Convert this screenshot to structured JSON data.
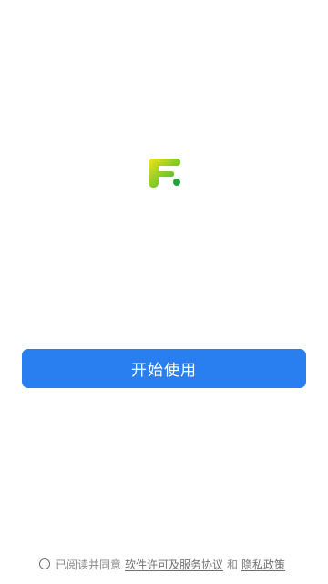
{
  "logo": {
    "icon": "app-f-logo-icon",
    "color_start": "#f2e21a",
    "color_end": "#1fa33a"
  },
  "main": {
    "start_button_label": "开始使用",
    "button_color": "#2a7ff0"
  },
  "agreement": {
    "prefix": "已阅读并同意",
    "license_link": "软件许可及服务协议",
    "conjunction": "和",
    "privacy_link": "隐私政策"
  }
}
